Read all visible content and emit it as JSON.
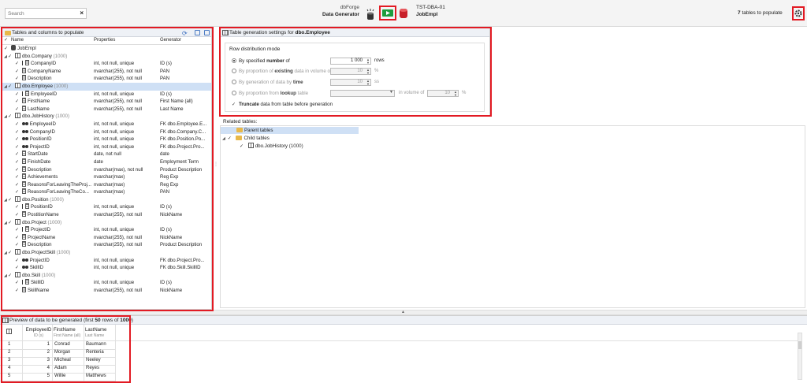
{
  "toolbar": {
    "search_placeholder": "Search",
    "clear_glyph": "×",
    "app_line1": "dbForge",
    "app_line2": "Data Generator",
    "server": "TST-DBA-01",
    "database": "JobEmpl",
    "tables_count": "7",
    "tables_label": "tables to populate",
    "icons": [
      "database-sync-icon",
      "play-generate-icon",
      "database-icon",
      "gear-icon"
    ],
    "accent_red": "#e21a23",
    "play_green": "#1e9e3e"
  },
  "left_panel": {
    "title": "Tables and columns to populate",
    "columns": [
      "Name",
      "Properties",
      "Generator"
    ],
    "rows": [
      {
        "level": 0,
        "type": "db",
        "name": "JobEmpl",
        "count": "",
        "props": "",
        "gen": "",
        "checked": true
      },
      {
        "level": 1,
        "type": "table",
        "name": "dbo.Company",
        "count": "(1000)",
        "props": "",
        "gen": "",
        "checked": true
      },
      {
        "level": 2,
        "type": "pk",
        "name": "CompanyID",
        "count": "",
        "props": "int, not null, unique",
        "gen": "ID (s)",
        "checked": true
      },
      {
        "level": 2,
        "type": "col",
        "name": "CompanyName",
        "count": "",
        "props": "nvarchar(255), not null",
        "gen": "PAN",
        "checked": true
      },
      {
        "level": 2,
        "type": "col",
        "name": "Description",
        "count": "",
        "props": "nvarchar(255), not null",
        "gen": "PAN",
        "checked": true
      },
      {
        "level": 1,
        "type": "table",
        "name": "dbo.Employee",
        "count": "(1000)",
        "props": "",
        "gen": "",
        "checked": true,
        "selected": true
      },
      {
        "level": 2,
        "type": "pk",
        "name": "EmployeeID",
        "count": "",
        "props": "int, not null, unique",
        "gen": "ID (s)",
        "checked": true
      },
      {
        "level": 2,
        "type": "col",
        "name": "FirstName",
        "count": "",
        "props": "nvarchar(255), not null",
        "gen": "First Name (all)",
        "checked": true
      },
      {
        "level": 2,
        "type": "col",
        "name": "LastName",
        "count": "",
        "props": "nvarchar(255), not null",
        "gen": "Last Name",
        "checked": true
      },
      {
        "level": 1,
        "type": "table",
        "name": "dbo.JobHistory",
        "count": "(1000)",
        "props": "",
        "gen": "",
        "checked": true
      },
      {
        "level": 2,
        "type": "fk",
        "name": "EmployeeID",
        "count": "",
        "props": "int, not null, unique",
        "gen": "FK dbo.Employee.E...",
        "checked": true
      },
      {
        "level": 2,
        "type": "fk",
        "name": "CompanyID",
        "count": "",
        "props": "int, not null, unique",
        "gen": "FK dbo.Company.C...",
        "checked": true
      },
      {
        "level": 2,
        "type": "fk",
        "name": "PositionID",
        "count": "",
        "props": "int, not null, unique",
        "gen": "FK dbo.Position.Po...",
        "checked": true
      },
      {
        "level": 2,
        "type": "fk",
        "name": "ProjectID",
        "count": "",
        "props": "int, not null, unique",
        "gen": "FK dbo.Project.Pro...",
        "checked": true
      },
      {
        "level": 2,
        "type": "col",
        "name": "StartDate",
        "count": "",
        "props": "date, not null",
        "gen": "date",
        "checked": true
      },
      {
        "level": 2,
        "type": "col",
        "name": "FinishDate",
        "count": "",
        "props": "date",
        "gen": "Employment Term",
        "checked": true
      },
      {
        "level": 2,
        "type": "col",
        "name": "Description",
        "count": "",
        "props": "nvarchar(max), not null",
        "gen": "Product Description",
        "checked": true
      },
      {
        "level": 2,
        "type": "col",
        "name": "Achievements",
        "count": "",
        "props": "nvarchar(max)",
        "gen": "Reg Exp",
        "checked": true
      },
      {
        "level": 2,
        "type": "col",
        "name": "ReasonsForLeavingTheProj...",
        "count": "",
        "props": "nvarchar(max)",
        "gen": "Reg Exp",
        "checked": true
      },
      {
        "level": 2,
        "type": "col",
        "name": "ReasonsForLeavingTheCo...",
        "count": "",
        "props": "nvarchar(max)",
        "gen": "PAN",
        "checked": true
      },
      {
        "level": 1,
        "type": "table",
        "name": "dbo.Position",
        "count": "(1000)",
        "props": "",
        "gen": "",
        "checked": true
      },
      {
        "level": 2,
        "type": "pk",
        "name": "PositionID",
        "count": "",
        "props": "int, not null, unique",
        "gen": "ID (s)",
        "checked": true
      },
      {
        "level": 2,
        "type": "col",
        "name": "PostitionName",
        "count": "",
        "props": "nvarchar(255), not null",
        "gen": "NickName",
        "checked": true
      },
      {
        "level": 1,
        "type": "table",
        "name": "dbo.Project",
        "count": "(1000)",
        "props": "",
        "gen": "",
        "checked": true
      },
      {
        "level": 2,
        "type": "pk",
        "name": "ProjectID",
        "count": "",
        "props": "int, not null, unique",
        "gen": "ID (s)",
        "checked": true
      },
      {
        "level": 2,
        "type": "col",
        "name": "ProjectName",
        "count": "",
        "props": "nvarchar(255), not null",
        "gen": "NickName",
        "checked": true
      },
      {
        "level": 2,
        "type": "col",
        "name": "Description",
        "count": "",
        "props": "nvarchar(255), not null",
        "gen": "Product Description",
        "checked": true
      },
      {
        "level": 1,
        "type": "table",
        "name": "dbo.ProjectSkill",
        "count": "(1000)",
        "props": "",
        "gen": "",
        "checked": true
      },
      {
        "level": 2,
        "type": "fk",
        "name": "ProjectID",
        "count": "",
        "props": "int, not null, unique",
        "gen": "FK dbo.Project.Pro...",
        "checked": true
      },
      {
        "level": 2,
        "type": "fk",
        "name": "SkillID",
        "count": "",
        "props": "int, not null, unique",
        "gen": "FK dbo.Skill.SkillID",
        "checked": true
      },
      {
        "level": 1,
        "type": "table",
        "name": "dbo.Skill",
        "count": "(1000)",
        "props": "",
        "gen": "",
        "checked": true
      },
      {
        "level": 2,
        "type": "pk",
        "name": "SkillID",
        "count": "",
        "props": "int, not null, unique",
        "gen": "ID (s)",
        "checked": true
      },
      {
        "level": 2,
        "type": "col",
        "name": "SkillName",
        "count": "",
        "props": "nvarchar(255), not null",
        "gen": "NickName",
        "checked": true
      }
    ]
  },
  "settings": {
    "title_prefix": "Table generation settings for",
    "title_table": "dbo.Employee",
    "group_title": "Row distribution mode",
    "options": {
      "by_number": {
        "pre": "By specified",
        "bold": "number",
        "post": "of",
        "value": "1 000",
        "unit": "rows",
        "selected": true
      },
      "by_existing": {
        "pre": "By proportion of",
        "bold": "existing",
        "post": "data in volume of",
        "value": "10",
        "unit": "%",
        "selected": false
      },
      "by_time": {
        "pre": "By generation of data by",
        "bold": "time",
        "post": "",
        "value": "10",
        "unit": "ss",
        "selected": false
      },
      "by_lookup": {
        "pre": "By proportion from",
        "bold": "lookup",
        "post": "table",
        "volume_label": "in volume of",
        "value": "10",
        "unit": "%",
        "selected": false
      }
    },
    "truncate": {
      "bold": "Truncate",
      "post": "data from table before generation",
      "checked": true
    }
  },
  "related": {
    "label": "Related tables:",
    "parent": "Parent tables",
    "child": "Child tables",
    "child_table": "dbo.JobHistory",
    "child_count": "(1000)"
  },
  "preview": {
    "title_pre": "Preview of data to be generated (first",
    "title_n": "50",
    "title_mid": "rows of",
    "title_total": "1000",
    "title_post": ")",
    "columns": [
      {
        "name": "EmployeeID",
        "sub": "ID (s)"
      },
      {
        "name": "FirstName",
        "sub": "First Name (all)"
      },
      {
        "name": "LastName",
        "sub": "Last Name"
      }
    ],
    "rows": [
      {
        "n": "1",
        "id": "1",
        "first": "Conrad",
        "last": "Baumann"
      },
      {
        "n": "2",
        "id": "2",
        "first": "Morgan",
        "last": "Renteria"
      },
      {
        "n": "3",
        "id": "3",
        "first": "Micheal",
        "last": "Neeley"
      },
      {
        "n": "4",
        "id": "4",
        "first": "Adam",
        "last": "Reyes"
      },
      {
        "n": "5",
        "id": "5",
        "first": "Willie",
        "last": "Matthews"
      }
    ]
  }
}
